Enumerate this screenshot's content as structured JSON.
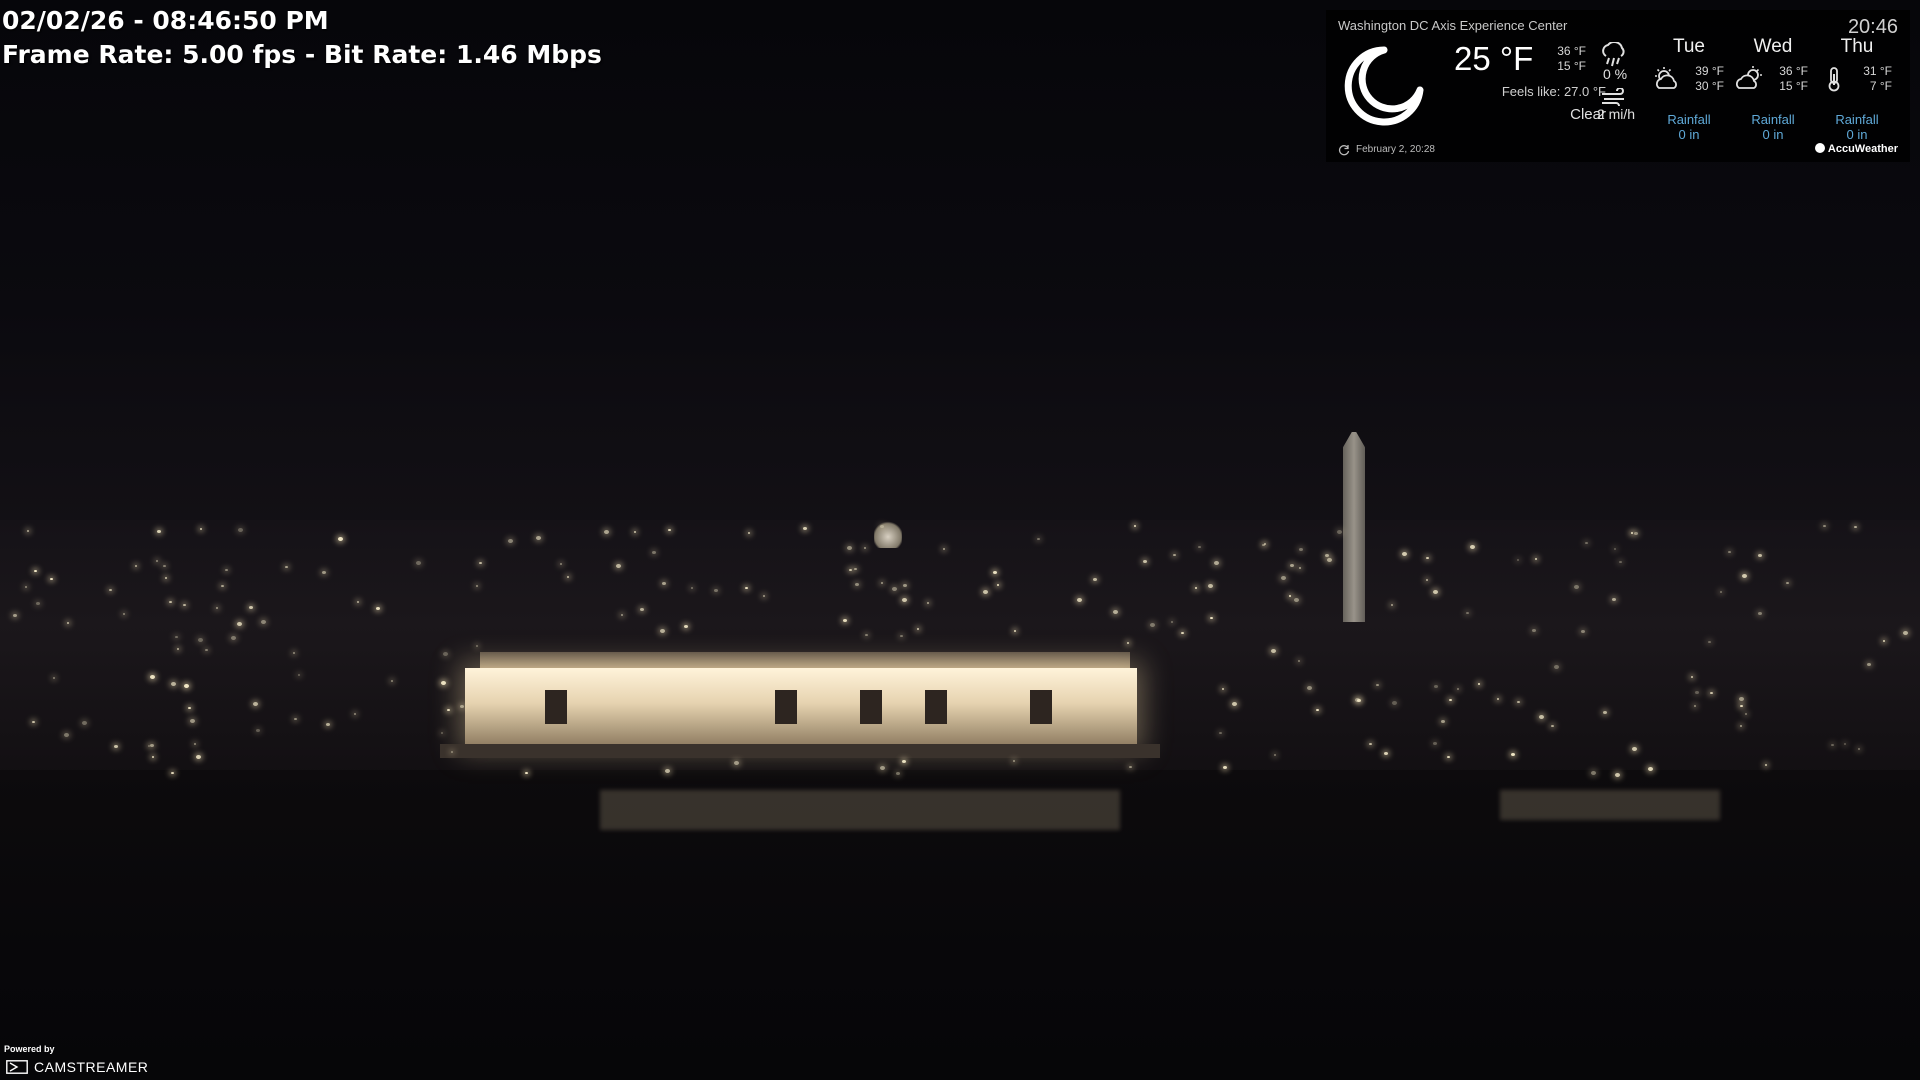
{
  "overlay": {
    "timestamp": "02/02/26 - 08:46:50 PM",
    "stream_stats": "Frame Rate:  5.00 fps - Bit Rate:  1.46 Mbps"
  },
  "weather": {
    "location": "Washington DC Axis Experience Center",
    "time": "20:46",
    "current_icon": "moon-icon",
    "temperature": "25 °F",
    "high": "36 °F",
    "low": "15 °F",
    "feels_like": "Feels like: 27.0 °F",
    "condition": "Clear",
    "precip_icon": "rain-cloud-icon",
    "precip": "0 %",
    "wind_icon": "wind-icon",
    "wind": "2 mi/h",
    "forecast": [
      {
        "day": "Tue",
        "icon": "partly-cloudy-sun-icon",
        "high": "39 °F",
        "low": "30 °F",
        "label": "Rainfall",
        "value": "0 in"
      },
      {
        "day": "Wed",
        "icon": "partly-cloudy-sun-icon",
        "high": "36 °F",
        "low": "15 °F",
        "label": "Rainfall",
        "value": "0 in"
      },
      {
        "day": "Thu",
        "icon": "thermometer-icon",
        "high": "31 °F",
        "low": "7 °F",
        "label": "Rainfall",
        "value": "0 in"
      }
    ],
    "updated": "February  2, 20:28",
    "brand": "AccuWeather"
  },
  "footer": {
    "powered_by": "Powered by",
    "brand": "CAMSTREAMER"
  }
}
